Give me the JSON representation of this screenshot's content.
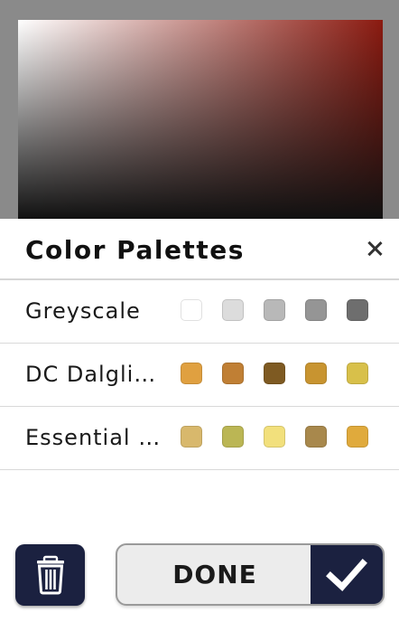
{
  "sheet": {
    "title": "Color Palettes",
    "close_icon": "close-icon"
  },
  "palettes": [
    {
      "name": "Greyscale",
      "colors": [
        "#ffffff",
        "#dcdcdc",
        "#b8b8b8",
        "#959595",
        "#6e6e6e"
      ]
    },
    {
      "name": "DC Dalgli…",
      "colors": [
        "#e0a040",
        "#c07f34",
        "#7e5a22",
        "#c89430",
        "#d8c04a"
      ]
    },
    {
      "name": "Essential …",
      "colors": [
        "#d8b86c",
        "#bbb654",
        "#f2e07c",
        "#a8884c",
        "#e0aa3c"
      ]
    }
  ],
  "actions": {
    "done_label": "DONE",
    "trash_icon": "trash-icon",
    "check_icon": "check-icon"
  },
  "colors": {
    "accent_navy": "#1b2140",
    "picker_hue": "#8b1a10"
  }
}
